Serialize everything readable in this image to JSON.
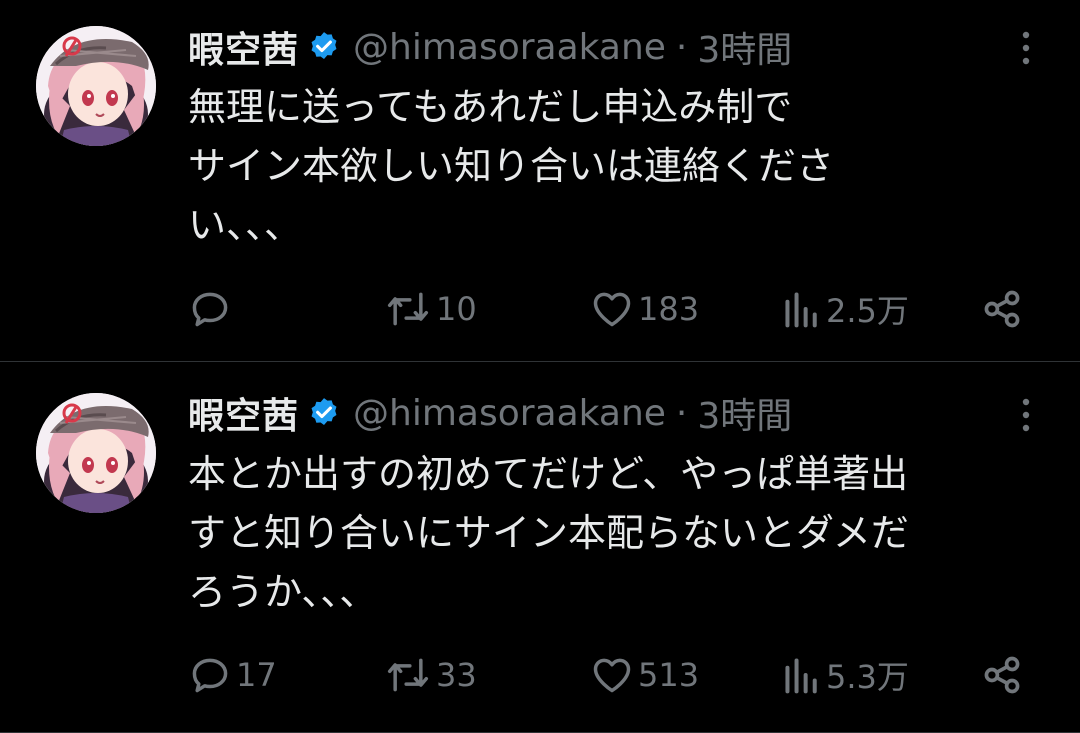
{
  "colors": {
    "background": "#000000",
    "text_primary": "#e7e9ea",
    "text_secondary": "#71767b",
    "verified_badge": "#1d9bf0",
    "divider": "#2f3336"
  },
  "icons": {
    "verified": "verified-badge-icon",
    "more": "more-vertical-icon",
    "reply": "reply-icon",
    "retweet": "retweet-icon",
    "like": "heart-icon",
    "views": "views-chart-icon",
    "share": "share-icon"
  },
  "tweets": [
    {
      "display_name": "暇空茜",
      "handle": "@himasoraakane",
      "separator": "·",
      "time": "3時間",
      "lines": [
        "無理に送ってもあれだし申込み制で",
        "サイン本欲しい知り合いは連絡くださ",
        "い、、、"
      ],
      "reply_count": "",
      "retweet_count": "10",
      "like_count": "183",
      "view_count": "2.5万"
    },
    {
      "display_name": "暇空茜",
      "handle": "@himasoraakane",
      "separator": "·",
      "time": "3時間",
      "lines": [
        "本とか出すの初めてだけど、やっぱ単著出",
        "すと知り合いにサイン本配らないとダメだ",
        "ろうか、、、"
      ],
      "reply_count": "17",
      "retweet_count": "33",
      "like_count": "513",
      "view_count": "5.3万"
    }
  ]
}
